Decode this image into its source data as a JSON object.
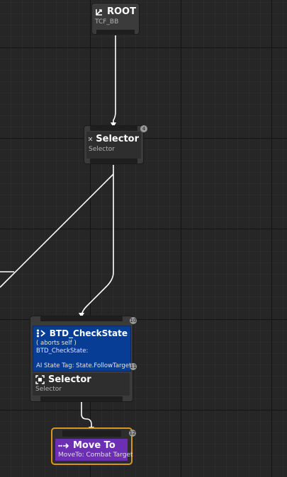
{
  "nodes": {
    "root": {
      "title": "ROOT",
      "subtitle": "TCF_BB",
      "icon": "root-icon"
    },
    "selector_top": {
      "title": "Selector",
      "subtitle": "Selector",
      "icon": "selector-icon",
      "badge": "4"
    },
    "check_state": {
      "badge": "10",
      "decorator": {
        "title": "BTD_CheckState",
        "icon": "decorator-icon",
        "line1": "( aborts self )",
        "line2": "BTD_CheckState:",
        "line3": "AI State Tag: State.FollowTarget",
        "badge": "11"
      },
      "selector": {
        "title": "Selector",
        "subtitle": "Selector",
        "icon": "selector-icon"
      }
    },
    "move_to": {
      "title": "Move To",
      "subtitle": "MoveTo: Combat Target",
      "icon": "move-to-icon",
      "badge": "12",
      "highlight_color": "#d9961e"
    }
  },
  "colors": {
    "graph_bg": "#262626",
    "node_bg": "#3b3b3b",
    "decorator_bg": "#073d94",
    "task_bg": "#6c2fb4",
    "wire": "#ffffff"
  }
}
